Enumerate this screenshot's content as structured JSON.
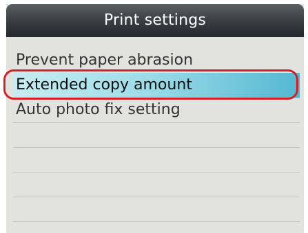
{
  "screen": {
    "title": "Print settings"
  },
  "menu": {
    "items": [
      {
        "label": "Prevent paper abrasion",
        "selected": false
      },
      {
        "label": "Extended copy amount",
        "selected": true
      },
      {
        "label": "Auto photo fix setting",
        "selected": false
      },
      {
        "label": "",
        "selected": false
      },
      {
        "label": "",
        "selected": false
      },
      {
        "label": "",
        "selected": false
      },
      {
        "label": "",
        "selected": false
      }
    ]
  },
  "colors": {
    "header_dark": "#23282c",
    "selection_cyan": "#54b8d2",
    "callout_red": "#d51f26"
  }
}
